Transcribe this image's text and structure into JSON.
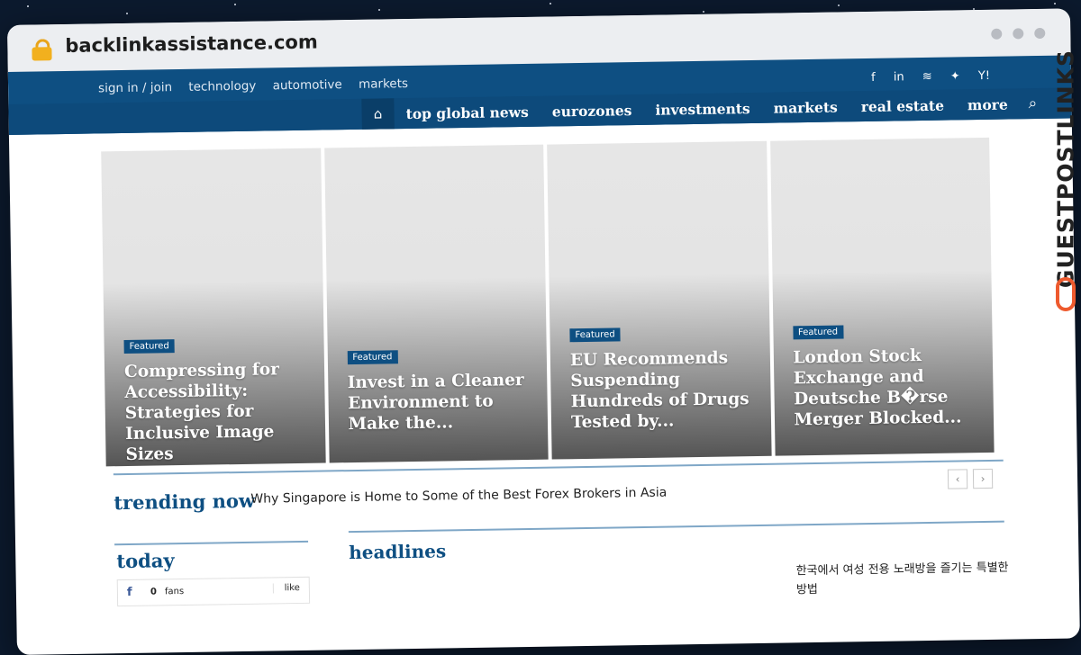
{
  "browser": {
    "url": "backlinkassistance.com"
  },
  "topnav": [
    "sign in / join",
    "technology",
    "automotive",
    "markets"
  ],
  "social_icons": [
    "facebook-icon",
    "linkedin-icon",
    "rss-icon",
    "twitter-icon",
    "yahoo-icon"
  ],
  "social_glyphs": [
    "f",
    "in",
    "⟟",
    "🐦",
    "Y!"
  ],
  "mainnav": {
    "home_icon": "home-icon",
    "items": [
      "top global news",
      "eurozones",
      "investments",
      "markets",
      "real estate",
      "more"
    ],
    "search_icon": "search-icon"
  },
  "featured": [
    {
      "badge": "Featured",
      "title": "Compressing for Accessibility: Strategies for Inclusive Image Sizes"
    },
    {
      "badge": "Featured",
      "title": "Invest in a Cleaner Environment to Make the..."
    },
    {
      "badge": "Featured",
      "title": "EU Recommends Suspending Hundreds of Drugs Tested by..."
    },
    {
      "badge": "Featured",
      "title": "London Stock Exchange and Deutsche B�rse Merger Blocked..."
    }
  ],
  "trending": {
    "label": "trending now",
    "text": "Why Singapore is Home to Some of the Best Forex Brokers in Asia",
    "prev": "‹",
    "next": "›"
  },
  "today": {
    "label": "today",
    "fb_glyph": "f",
    "fans_count": "0",
    "fans_label": "fans",
    "like_label": "like"
  },
  "headlines": {
    "label": "headlines",
    "side_text": "한국에서 여성 전용 노래방을 즐기는 특별한 방법"
  },
  "watermark": "GUESTPOSTLINKS",
  "colors": {
    "brand_blue": "#0e4f82",
    "accent_orange": "#ee5a2e",
    "lock_gold": "#f2b01e"
  }
}
